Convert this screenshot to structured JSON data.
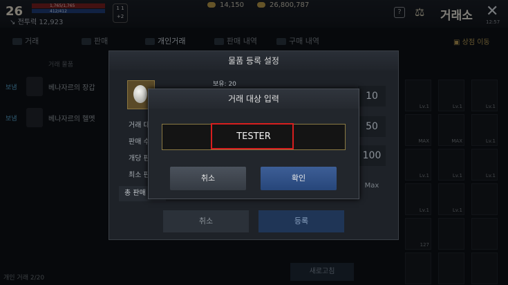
{
  "player": {
    "level": "26",
    "hp": "1,765/1,765",
    "mp": "412/412",
    "combat_label": "전투력",
    "combat_value": "12,923",
    "emblem": "1 1\n+2"
  },
  "currency": {
    "silver": "14,150",
    "gold": "26,800,787"
  },
  "header": {
    "title": "거래소",
    "time": "12:57"
  },
  "tabs": [
    "거래",
    "판매",
    "개인거래",
    "판매 내역",
    "구매 내역"
  ],
  "shop_move": "상점 이동",
  "list": {
    "column_header": "거래 물품",
    "rows": [
      {
        "badge": "보냄",
        "name": "베나자르의 장갑"
      },
      {
        "badge": "보냄",
        "name": "베나자르의 헬멧"
      }
    ],
    "footer": "개인 거래 2/20",
    "refresh": "새로고침"
  },
  "register_dialog": {
    "title": "물품 등록 설정",
    "holding": "보유: 20",
    "labels": [
      "거래 대",
      "판매 수",
      "개당 판",
      "최소 판"
    ],
    "total_label": "총 판매",
    "values": [
      "10",
      "50",
      "100"
    ],
    "max": "Max",
    "cancel": "취소",
    "register": "등록"
  },
  "target_dialog": {
    "title": "거래 대상 입력",
    "value": "TESTER",
    "cancel": "취소",
    "confirm": "확인"
  },
  "grid_slots": [
    {
      "lv": "Lv.1"
    },
    {
      "lv": "Lv.1"
    },
    {
      "lv": "Lv.1"
    },
    {
      "lv": "MAX"
    },
    {
      "lv": "MAX"
    },
    {
      "lv": "Lv.1"
    },
    {
      "lv": "Lv.1"
    },
    {
      "lv": "Lv.1"
    },
    {
      "lv": "Lv.1"
    },
    {
      "lv": "Lv.1"
    },
    {
      "lv": "Lv.1"
    },
    {
      "lv": ""
    },
    {
      "lv": "127"
    },
    {
      "lv": ""
    },
    {
      "lv": ""
    },
    {
      "lv": ""
    },
    {
      "lv": ""
    },
    {
      "lv": ""
    }
  ]
}
